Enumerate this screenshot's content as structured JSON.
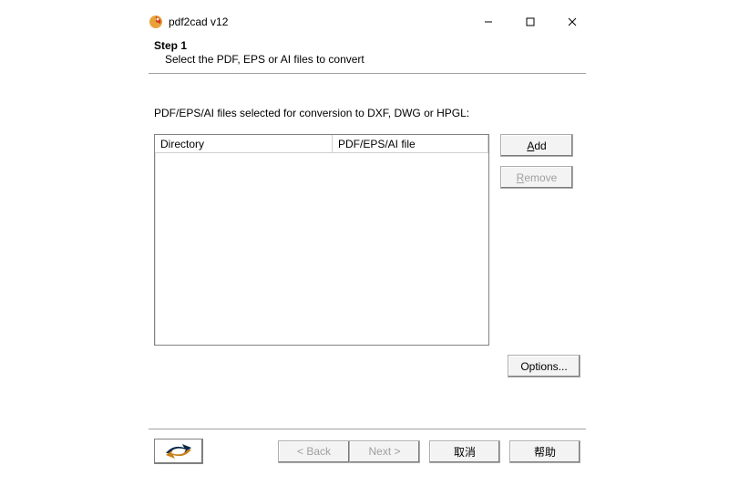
{
  "titlebar": {
    "title": "pdf2cad v12"
  },
  "step": {
    "title": "Step 1",
    "subtitle": "Select the PDF, EPS or AI files to convert"
  },
  "content": {
    "label": "PDF/EPS/AI files selected for conversion to DXF, DWG or HPGL:",
    "columns": {
      "directory": "Directory",
      "file": "PDF/EPS/AI file"
    }
  },
  "buttons": {
    "add": "Add",
    "remove": "Remove",
    "options": "Options...",
    "back": "< Back",
    "next": "Next >",
    "cancel": "取消",
    "help": "帮助"
  }
}
